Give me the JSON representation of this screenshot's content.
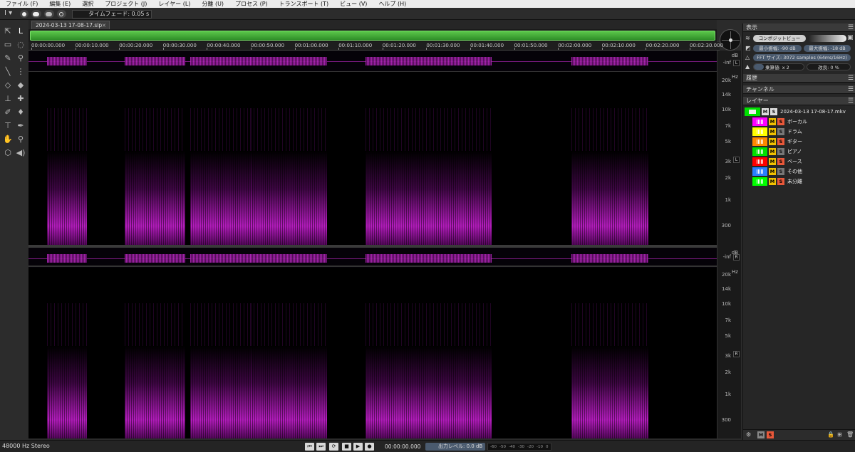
{
  "menu": [
    "ファイル (F)",
    "編集 (E)",
    "選択",
    "プロジェクト (J)",
    "レイヤー (L)",
    "分離 (U)",
    "プロセス (P)",
    "トランスポート (T)",
    "ビュー (V)",
    "ヘルプ (H)"
  ],
  "options": {
    "time_fade": "タイムフェード: 0.05 s"
  },
  "tab": {
    "filename": "2024-03-13 17-08-17.slp",
    "close": "×"
  },
  "ruler": {
    "labels": [
      "00:00:00.000",
      "00:00:10.000",
      "00:00:20.000",
      "00:00:30.000",
      "00:00:40.000",
      "00:00:50.000",
      "00:01:00.000",
      "00:01:10.000",
      "00:01:20.000",
      "00:01:30.000",
      "00:01:40.000",
      "00:01:50.000",
      "00:02:00.000",
      "00:02:10.000",
      "00:02:20.000",
      "00:02:30.000"
    ]
  },
  "scale": {
    "db_unit": "dB",
    "inf": "-inf",
    "hz_unit": "Hz",
    "freqs": [
      "20k",
      "14k",
      "10k",
      "7k",
      "5k",
      "3k",
      "2k",
      "1k",
      "300"
    ],
    "left": "L",
    "right": "R"
  },
  "panel": {
    "display_title": "表示",
    "composite_view": "コンポジットビュー",
    "min_amp": "最小振幅: -90 dB",
    "max_amp": "最大振幅: -18 dB",
    "fft_size": "FFT サイズ: 3072 samples (64ms/16Hz)",
    "multiplier": "乗算値: x 2",
    "improvement": "改良: 0 %",
    "history_title": "履歴",
    "channels_title": "チャンネル",
    "layers_title": "レイヤー",
    "file_layer": "2024-03-13 17-08-17.mkv",
    "m": "M",
    "s": "S"
  },
  "layers": [
    {
      "name": "ボーカル",
      "color": "#ff00ff"
    },
    {
      "name": "ドラム",
      "color": "#ffff00"
    },
    {
      "name": "ギター",
      "color": "#ff8800"
    },
    {
      "name": "ピアノ",
      "color": "#00e000"
    },
    {
      "name": "ベース",
      "color": "#ff0000"
    },
    {
      "name": "その他",
      "color": "#2a7fff"
    },
    {
      "name": "未分離",
      "color": "#00ff00"
    }
  ],
  "status": {
    "format": "48000 Hz Stereo",
    "timecode": "00:00:00.000",
    "output_level": "出力レベル: 0.0 dB",
    "meter_ticks": [
      "-60",
      "-50",
      "-40",
      "-30",
      "-20",
      "-10",
      "0"
    ]
  },
  "colors": {
    "spectrogram": "#b026b8",
    "overview": "#4cc03c",
    "accent": "#4a5a6e"
  }
}
